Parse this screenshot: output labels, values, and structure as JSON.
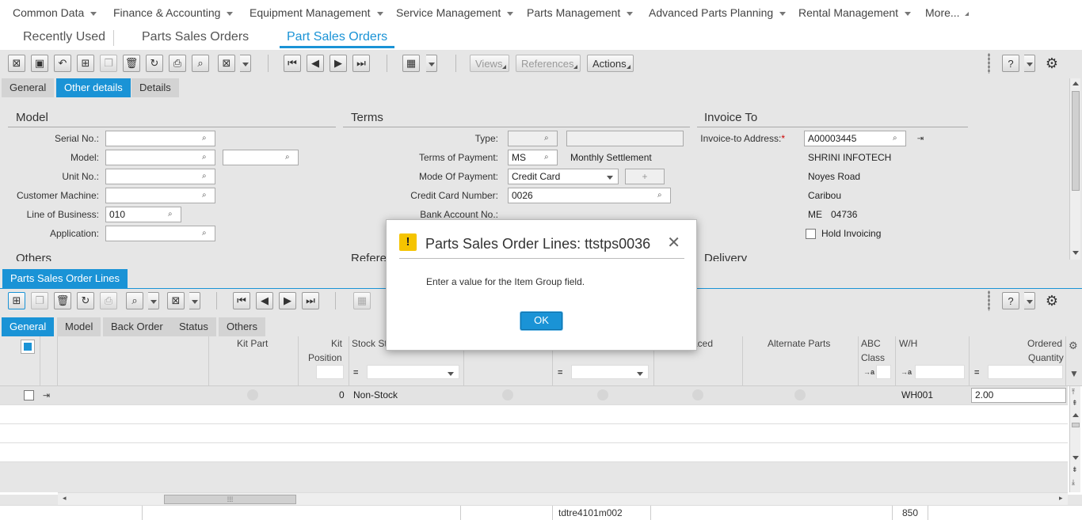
{
  "top_menu": [
    "Common Data",
    "Finance & Accounting",
    "Equipment Management",
    "Service Management",
    "Parts Management",
    "Advanced Parts Planning",
    "Rental Management",
    "More..."
  ],
  "session_tabs": [
    "Recently Used",
    "Parts Sales Orders",
    "Part Sales Orders"
  ],
  "toolbar": {
    "views": "Views",
    "references": "References",
    "actions": "Actions"
  },
  "form_tabs": [
    "General",
    "Other details",
    "Details"
  ],
  "form": {
    "model_title": "Model",
    "terms_title": "Terms",
    "invoice_title": "Invoice To",
    "serial_no": "Serial No.:",
    "model": "Model:",
    "unit_no": "Unit No.:",
    "customer_machine": "Customer Machine:",
    "line_of_business": "Line of Business:",
    "line_of_business_value": "010",
    "application": "Application:",
    "others_title": "Others",
    "references_title": "Referen",
    "delivery_title": "Delivery",
    "type": "Type:",
    "terms_of_payment": "Terms of Payment:",
    "terms_of_payment_value": "MS",
    "terms_of_payment_desc": "Monthly Settlement",
    "mode_of_payment": "Mode Of Payment:",
    "mode_of_payment_value": "Credit Card",
    "credit_card_number": "Credit Card Number:",
    "credit_card_number_value": "0026",
    "bank_account_no": "Bank Account No.:",
    "invoice_to_address": "Invoice-to Address:",
    "invoice_to_address_value": "A00003445",
    "address_line1": "SHRINI INFOTECH",
    "address_line2": "Noyes Road",
    "address_line3": "Caribou",
    "address_state": "ME",
    "address_zip": "04736",
    "hold_invoicing": "Hold Invoicing"
  },
  "lines": {
    "tab": "Parts Sales Order Lines",
    "subtabs": [
      "General",
      "Model",
      "Back Order",
      "Status",
      "Others"
    ],
    "headers": {
      "kit_part": "Kit Part",
      "kit_position_1": "Kit",
      "kit_position_2": "Position",
      "stock_status": "Stock St",
      "replaced": "aced",
      "alternate_parts": "Alternate Parts",
      "abc_class_1": "ABC",
      "abc_class_2": "Class",
      "wh": "W/H",
      "ordered_qty_1": "Ordered",
      "ordered_qty_2": "Quantity"
    },
    "row": {
      "kit_position": "0",
      "stock_status": "Non-Stock",
      "warehouse": "WH001",
      "ordered_quantity": "2.00"
    }
  },
  "footer": {
    "session": "tdtre4101m002",
    "count": "850"
  },
  "dialog": {
    "title": "Parts Sales Order Lines: ttstps0036",
    "message": "Enter a value for the Item Group field.",
    "ok": "OK"
  },
  "colors": {
    "accent": "#1a93d6",
    "warning": "#f5c400"
  }
}
